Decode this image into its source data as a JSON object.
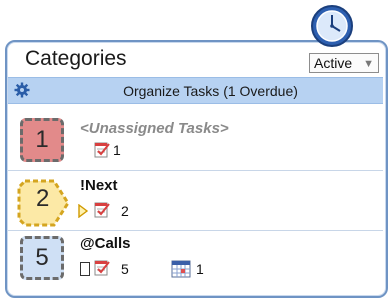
{
  "header": {
    "title": "Categories",
    "filter_value": "Active"
  },
  "organize": {
    "label": "Organize Tasks (1 Overdue)"
  },
  "categories": [
    {
      "badge_number": "1",
      "badge_color": "#e28a8a",
      "name": "<Unassigned Tasks>",
      "task_count": "1"
    },
    {
      "badge_number": "2",
      "badge_color": "#fce9a6",
      "name": "!Next",
      "task_count": "2"
    },
    {
      "badge_number": "5",
      "badge_color": "#cfe0f5",
      "name": "@Calls",
      "task_count": "5",
      "calendar_count": "1"
    }
  ],
  "colors": {
    "accent_border": "#6f94c4",
    "organize_bar": "#b7d2f2"
  },
  "icons": [
    "clock-icon",
    "gear-icon",
    "task-icon",
    "play-arrow-icon",
    "checkbox-icon",
    "calendar-icon",
    "dropdown-arrow-icon"
  ]
}
